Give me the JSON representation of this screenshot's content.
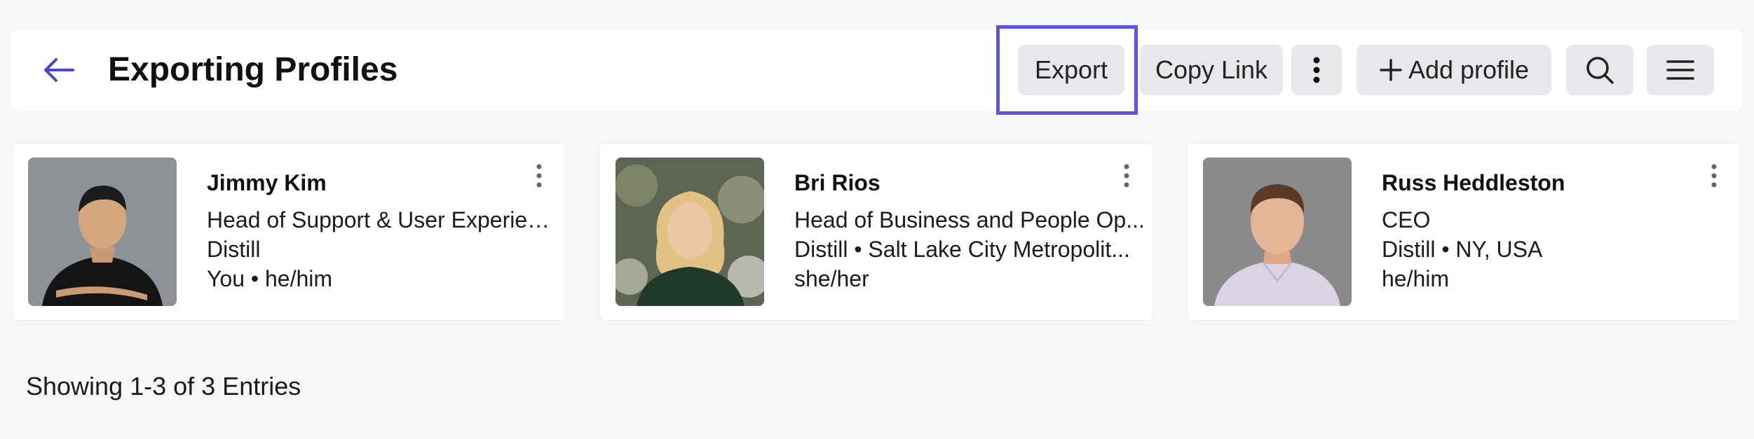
{
  "header": {
    "title": "Exporting Profiles",
    "back_icon": "arrow-left-icon",
    "export_label": "Export",
    "copy_link_label": "Copy Link",
    "more_icon": "vertical-dots-icon",
    "add_profile_label": "Add profile",
    "add_icon": "plus-icon",
    "search_icon": "search-icon",
    "menu_icon": "hamburger-menu-icon"
  },
  "profiles": [
    {
      "name": "Jimmy Kim",
      "line1": "Head of Support & User Experien...",
      "line2": "Distill",
      "line3": "You • he/him"
    },
    {
      "name": "Bri Rios",
      "line1": "Head of Business and People Op...",
      "line2": "Distill • Salt Lake City Metropolit...",
      "line3": "she/her"
    },
    {
      "name": "Russ Heddleston",
      "line1": "CEO",
      "line2": "Distill • NY, USA",
      "line3": "he/him"
    }
  ],
  "footer": {
    "entries_text": "Showing 1-3 of 3 Entries"
  },
  "colors": {
    "accent": "#5b54e6",
    "background": "#f6f7f9",
    "button_bg": "#e6e8ec"
  }
}
